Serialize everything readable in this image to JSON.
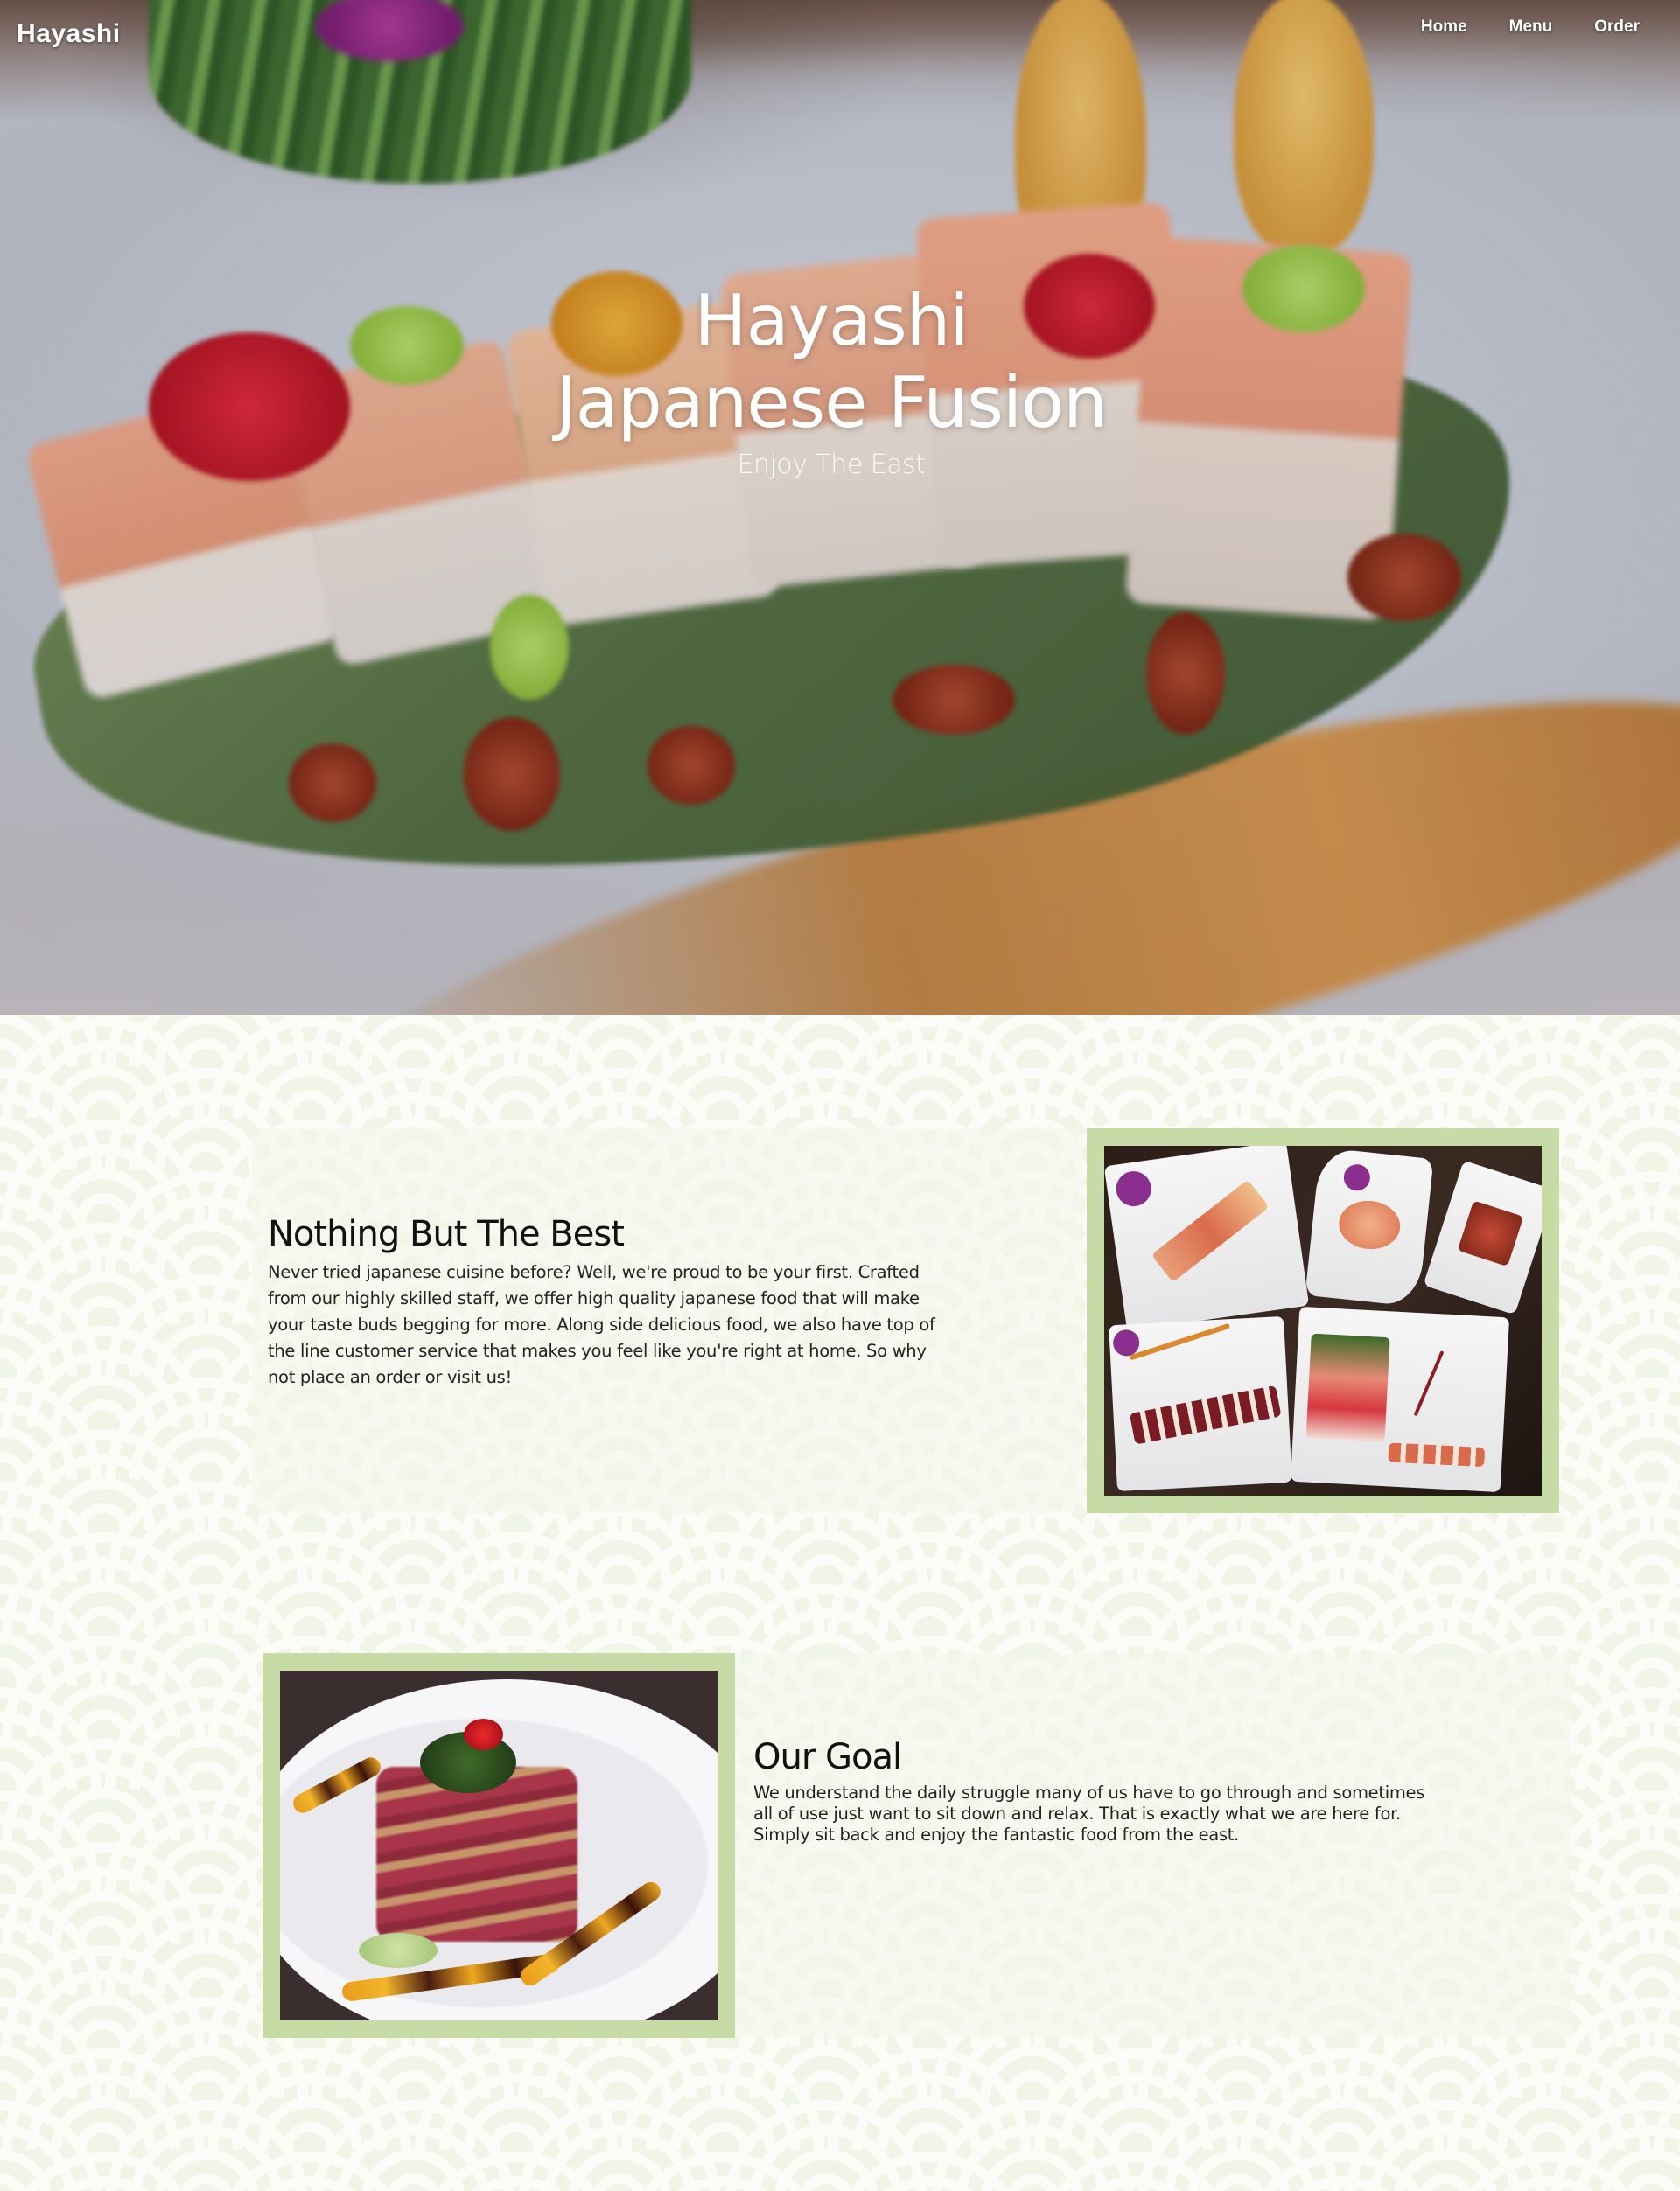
{
  "nav": {
    "brand": "Hayashi",
    "links": [
      "Home",
      "Menu",
      "Order"
    ]
  },
  "hero": {
    "title_line1": "Hayashi",
    "title_line2": "Japanese Fusion",
    "subtitle": "Enjoy The East"
  },
  "sections": [
    {
      "heading": "Nothing But The Best",
      "body": "Never tried japanese cuisine before? Well, we're proud to be your first. Crafted from our highly skilled staff, we offer high quality japanese food that will make your taste buds begging for more. Along side delicious food, we also have top of the line customer service that makes you feel like you're right at home. So why not place an order or visit us!"
    },
    {
      "heading": "Our Goal",
      "body": "We understand the daily struggle many of us have to go through and sometimes all of use just want to sit down and relax. That is exactly what we are here for. Simply sit back and enjoy the fantastic food from the east."
    }
  ],
  "colors": {
    "frame": "#c6dba5",
    "pattern_bg": "#f1f5e8",
    "pattern_wave": "#fbfcf8"
  }
}
